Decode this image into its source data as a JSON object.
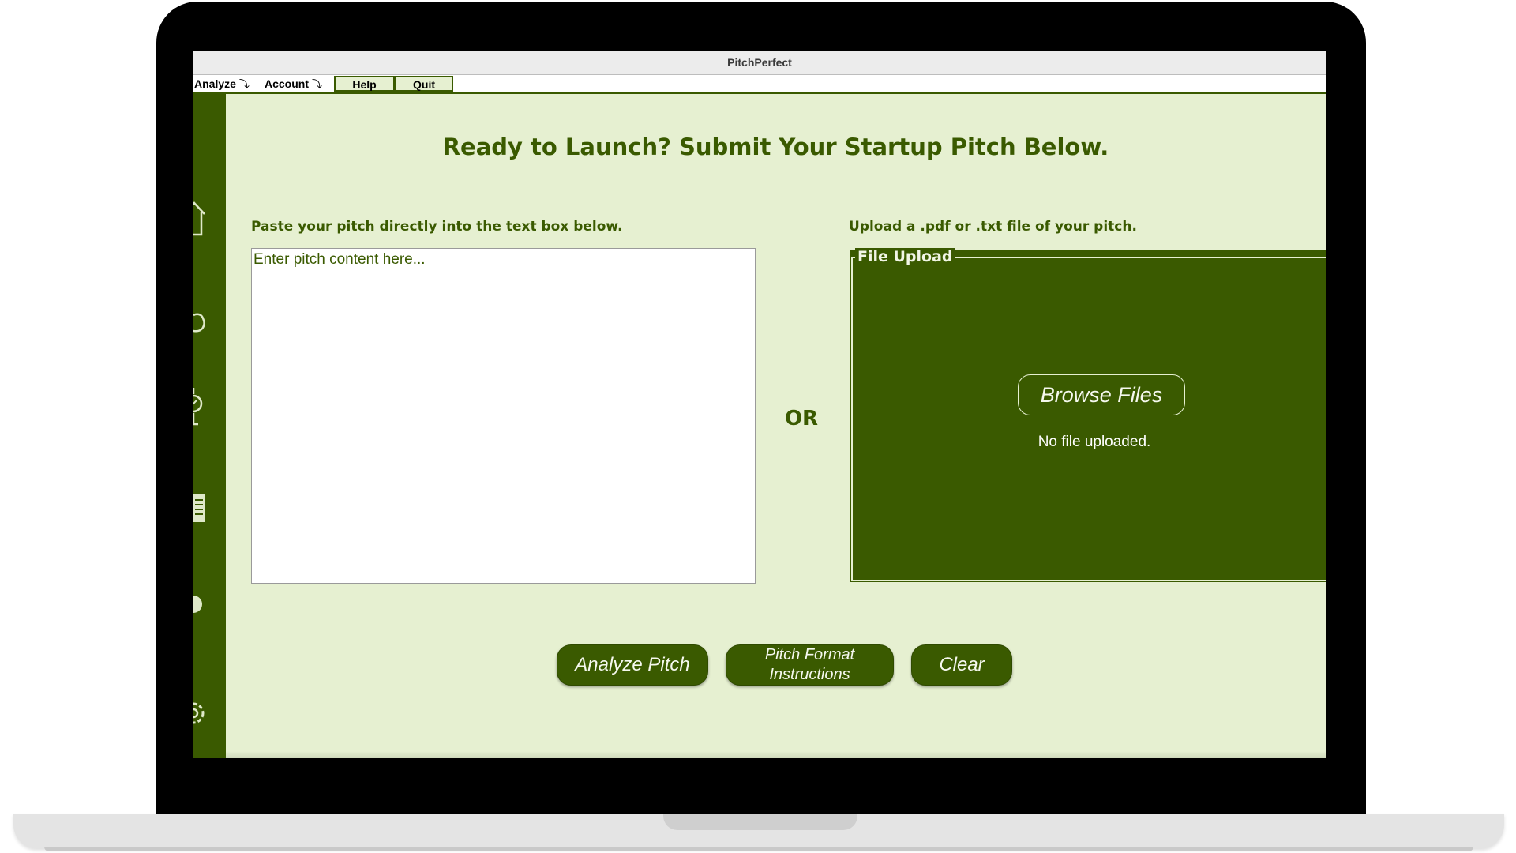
{
  "window": {
    "title": "PitchPerfect"
  },
  "menubar": {
    "items": [
      {
        "label": "Analyze",
        "type": "dropdown"
      },
      {
        "label": "Account",
        "type": "dropdown"
      },
      {
        "label": "Help",
        "type": "button"
      },
      {
        "label": "Quit",
        "type": "button"
      }
    ]
  },
  "sidebar": {
    "icons": [
      "home-icon",
      "hand-icon",
      "location-icon",
      "document-icon",
      "chat-icon",
      "settings-icon"
    ]
  },
  "main": {
    "headline": "Ready to Launch? Submit Your Startup Pitch Below.",
    "paste_label": "Paste your pitch directly into the text box below.",
    "pitch_input": {
      "placeholder": "Enter pitch content here...",
      "value": ""
    },
    "or_label": "OR",
    "upload_label": "Upload a .pdf or .txt file of your pitch.",
    "upload": {
      "legend": "File Upload",
      "browse_label": "Browse Files",
      "status": "No file uploaded."
    }
  },
  "actions": {
    "analyze_label": "Analyze Pitch",
    "format_line1": "Pitch Format",
    "format_line2": "Instructions",
    "clear_label": "Clear"
  },
  "colors": {
    "primary": "#3a5a00",
    "background": "#e6f0d1"
  }
}
